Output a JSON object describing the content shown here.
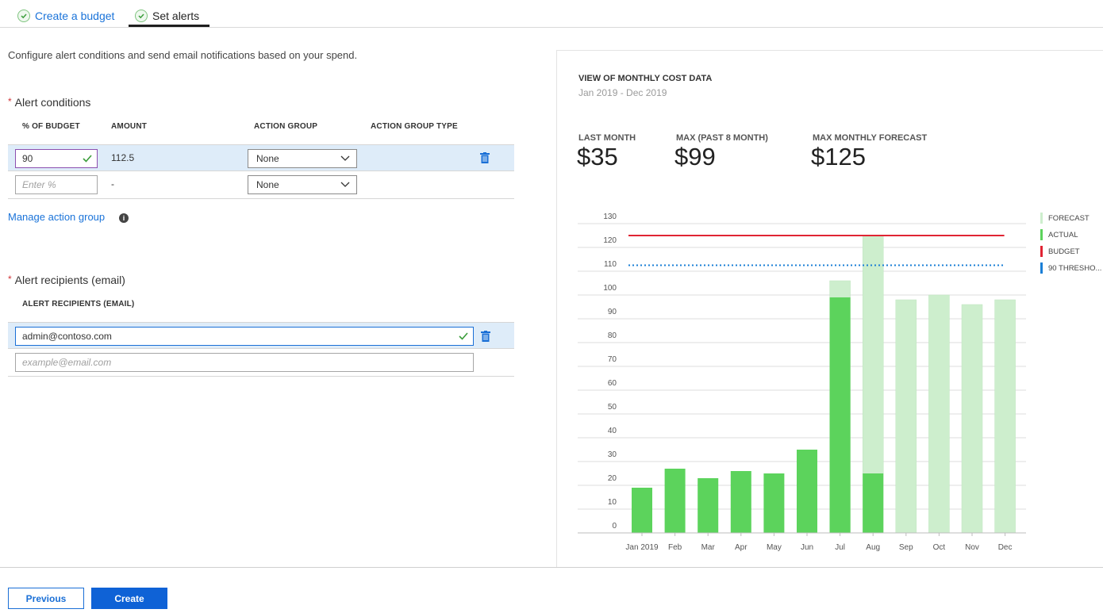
{
  "tabs": [
    {
      "label": "Create a budget",
      "state": "completed"
    },
    {
      "label": "Set alerts",
      "state": "active"
    }
  ],
  "intro": "Configure alert conditions and send email notifications based on your spend.",
  "alert_conditions": {
    "label": "Alert conditions",
    "required_mark": "*",
    "columns": [
      "% OF BUDGET",
      "AMOUNT",
      "ACTION GROUP",
      "ACTION GROUP TYPE"
    ],
    "rows": [
      {
        "percent": "90",
        "amount": "112.5",
        "action_group": "None",
        "action_group_type": ""
      },
      {
        "percent": "",
        "percent_placeholder": "Enter %",
        "amount": "-",
        "action_group": "None",
        "action_group_type": ""
      }
    ],
    "manage_link": "Manage action group",
    "info_icon": "i"
  },
  "alert_recipients": {
    "label": "Alert recipients (email)",
    "required_mark": "*",
    "column": "ALERT RECIPIENTS (EMAIL)",
    "rows": [
      {
        "email": "admin@contoso.com"
      },
      {
        "email": "",
        "placeholder": "example@email.com"
      }
    ]
  },
  "buttons": {
    "previous": "Previous",
    "create": "Create"
  },
  "card": {
    "title": "VIEW OF MONTHLY COST DATA",
    "subtitle": "Jan 2019 - Dec 2019",
    "kpis": [
      {
        "label": "LAST MONTH",
        "value": "$35"
      },
      {
        "label": "MAX (PAST 8 MONTH)",
        "value": "$99"
      },
      {
        "label": "MAX MONTHLY FORECAST",
        "value": "$125"
      }
    ]
  },
  "colors": {
    "accent": "#1a73d9",
    "actual": "#5cd35c",
    "forecast": "#cdeecd",
    "budget": "#e02433",
    "threshold": "#1a7fd6"
  },
  "chart_data": {
    "type": "bar",
    "title": "VIEW OF MONTHLY COST DATA",
    "subtitle": "Jan 2019 - Dec 2019",
    "categories": [
      "Jan 2019",
      "Feb",
      "Mar",
      "Apr",
      "May",
      "Jun",
      "Jul",
      "Aug",
      "Sep",
      "Oct",
      "Nov",
      "Dec"
    ],
    "series": [
      {
        "name": "FORECAST",
        "values": [
          null,
          null,
          null,
          null,
          null,
          null,
          106,
          125,
          98,
          100,
          96,
          98
        ]
      },
      {
        "name": "ACTUAL",
        "values": [
          19,
          27,
          23,
          26,
          25,
          35,
          99,
          25,
          null,
          null,
          null,
          null
        ]
      }
    ],
    "reference_lines": [
      {
        "name": "BUDGET",
        "value": 125,
        "style": "solid"
      },
      {
        "name": "90 THRESHO...",
        "value": 112.5,
        "style": "dotted"
      }
    ],
    "legend": [
      "FORECAST",
      "ACTUAL",
      "BUDGET",
      "90 THRESHO..."
    ],
    "legend_position": "right",
    "yticks": [
      0,
      10,
      20,
      30,
      40,
      50,
      60,
      70,
      80,
      90,
      100,
      110,
      120,
      130
    ],
    "ylim": [
      0,
      130
    ],
    "grid": true,
    "xlabel": "",
    "ylabel": ""
  }
}
